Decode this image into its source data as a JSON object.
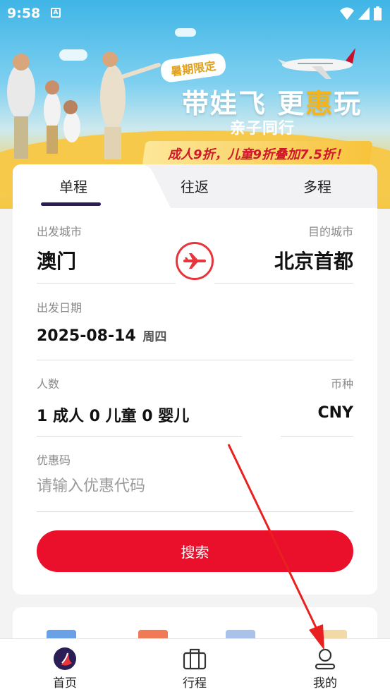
{
  "status_bar": {
    "time": "9:58",
    "notification_glyph": "A"
  },
  "banner": {
    "tag": "暑期限定",
    "title_part1": "带娃飞 更",
    "title_highlight": "惠",
    "title_part2": "玩",
    "subtitle": "亲子同行",
    "offer": "成人9折，儿童9折叠加7.5折！"
  },
  "tabs": [
    {
      "label": "单程",
      "active": true
    },
    {
      "label": "往返",
      "active": false
    },
    {
      "label": "多程",
      "active": false
    }
  ],
  "form": {
    "origin_label": "出发城市",
    "origin_value": "澳门",
    "destination_label": "目的城市",
    "destination_value": "北京首都",
    "date_label": "出发日期",
    "date_value": "2025-08-14",
    "weekday": "周四",
    "pax_label": "人数",
    "pax_value": "1 成人   0 儿童   0 婴儿",
    "currency_label": "币种",
    "currency_value": "CNY",
    "promo_label": "优惠码",
    "promo_placeholder": "请输入优惠代码",
    "promo_value": "",
    "search_label": "搜索"
  },
  "bottom_nav": [
    {
      "label": "首页",
      "icon": "airline-logo-icon",
      "active": true
    },
    {
      "label": "行程",
      "icon": "briefcase-icon",
      "active": false
    },
    {
      "label": "我的",
      "icon": "profile-icon",
      "active": false
    }
  ],
  "colors": {
    "brand_red": "#ea0f2a",
    "tab_indicator": "#2b1e57",
    "offer_red": "#d0182a"
  }
}
